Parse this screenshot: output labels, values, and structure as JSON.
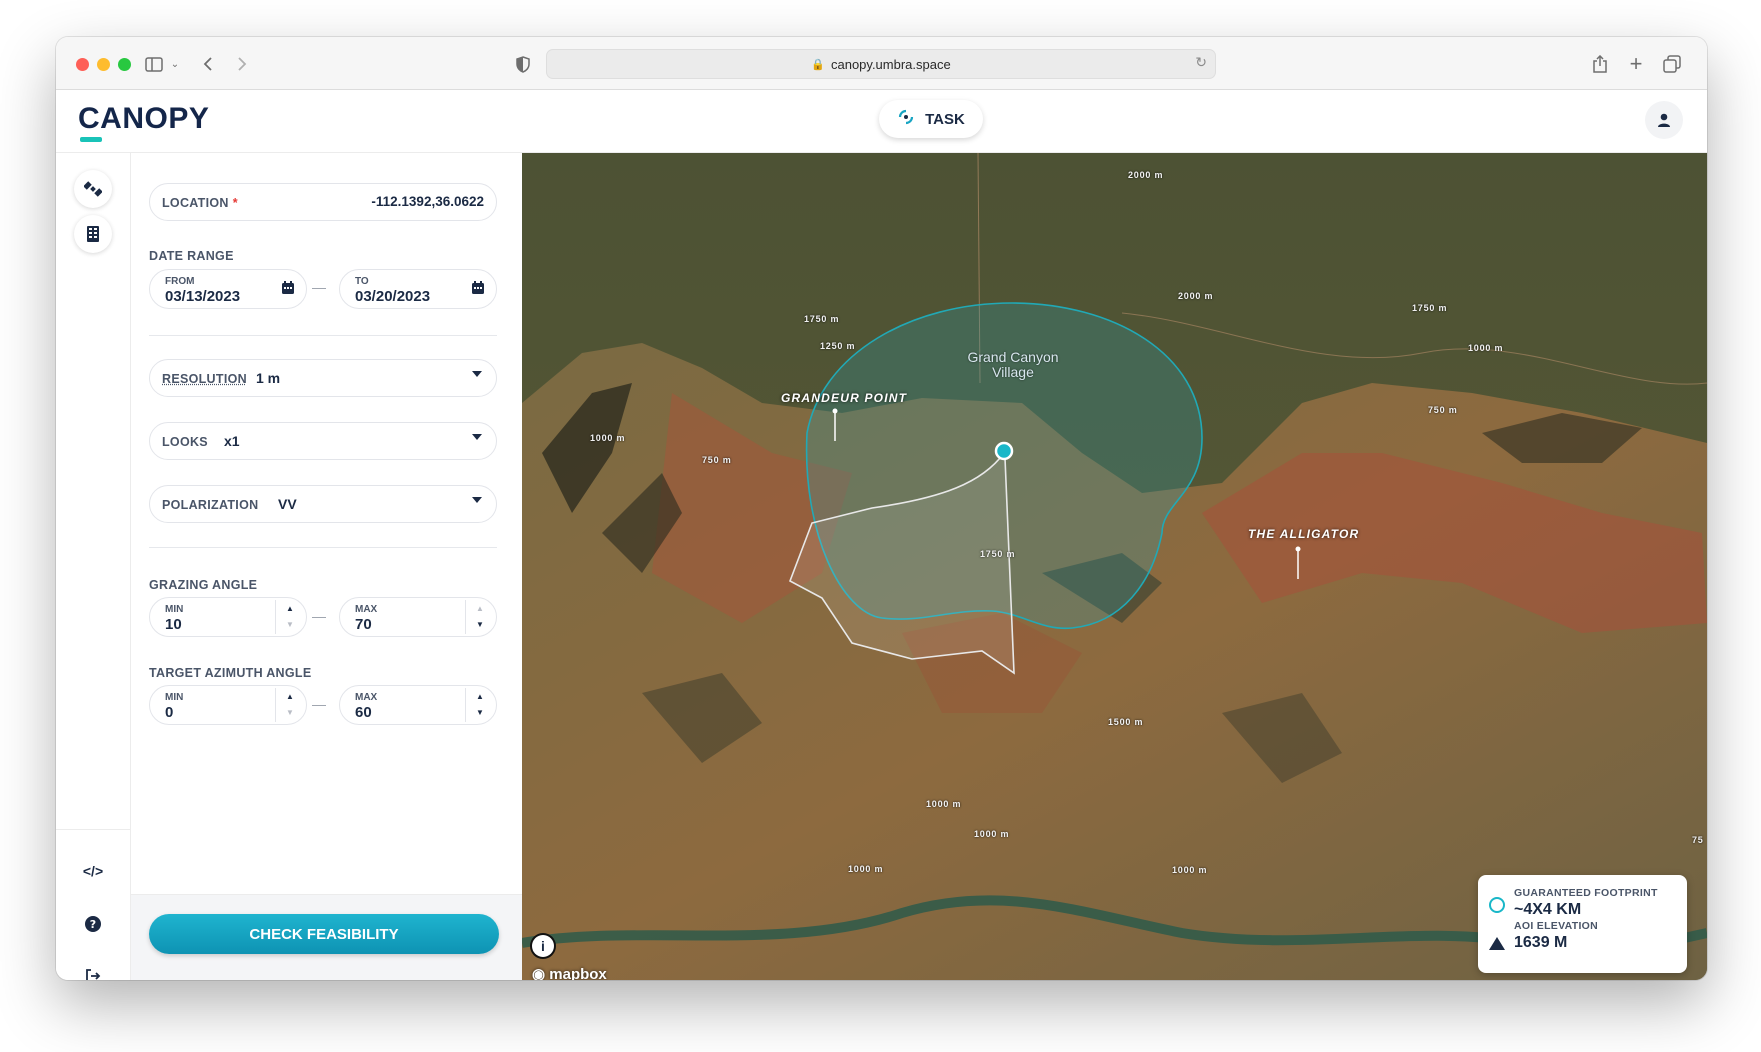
{
  "browser": {
    "url": "canopy.umbra.space"
  },
  "header": {
    "logo_text": "CANOPY",
    "task_label": "TASK"
  },
  "form": {
    "location": {
      "label": "LOCATION",
      "required_mark": "*",
      "value": "-112.1392,36.0622"
    },
    "date_range": {
      "label": "DATE RANGE",
      "from_label": "FROM",
      "from_value": "03/13/2023",
      "to_label": "TO",
      "to_value": "03/20/2023"
    },
    "resolution": {
      "label": "RESOLUTION",
      "value": "1 m"
    },
    "looks": {
      "label": "LOOKS",
      "value": "x1"
    },
    "polarization": {
      "label": "POLARIZATION",
      "value": "VV"
    },
    "grazing_angle": {
      "label": "GRAZING ANGLE",
      "min_label": "MIN",
      "min_value": "10",
      "max_label": "MAX",
      "max_value": "70"
    },
    "target_azimuth": {
      "label": "TARGET AZIMUTH ANGLE",
      "min_label": "MIN",
      "min_value": "0",
      "max_label": "MAX",
      "max_value": "60"
    },
    "submit_label": "CHECK FEASIBILITY"
  },
  "map": {
    "places": {
      "grandeur_point": "GRANDEUR POINT",
      "alligator": "THE ALLIGATOR",
      "village": "Grand Canyon Village"
    },
    "contours": [
      "2000 m",
      "2000 m",
      "1750 m",
      "1250 m",
      "1750 m",
      "1000 m",
      "750 m",
      "1000 m",
      "750 m",
      "1750 m",
      "1500 m",
      "1000 m",
      "1000 m",
      "1000 m",
      "1000 m",
      "75"
    ],
    "attribution": "mapbox",
    "info_card": {
      "footprint_label": "GUARANTEED FOOTPRINT",
      "footprint_value": "~4X4 KM",
      "elevation_label": "AOI ELEVATION",
      "elevation_value": "1639 M"
    }
  },
  "colors": {
    "accent": "#19b7c8",
    "brand_navy": "#14264a",
    "required": "#e53935"
  }
}
